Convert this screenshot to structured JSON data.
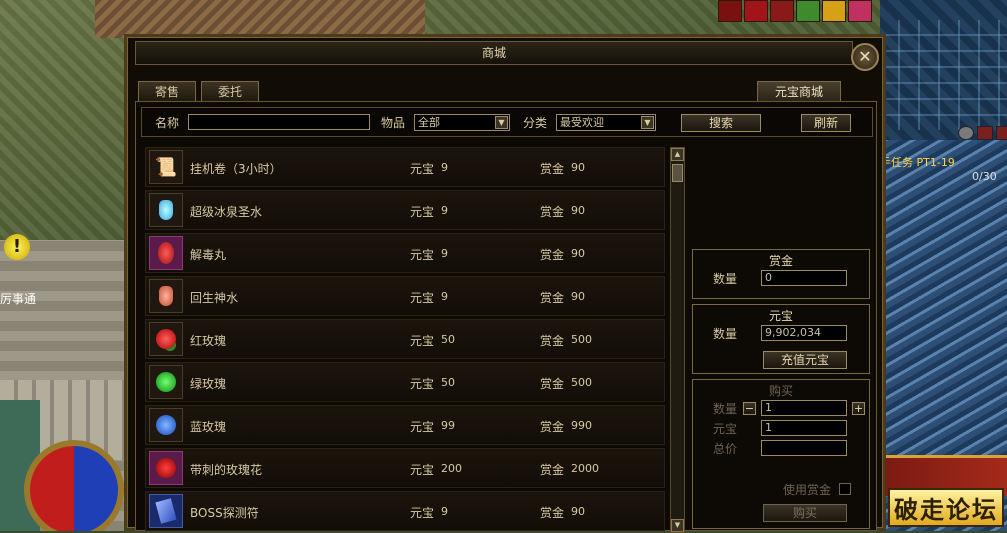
{
  "dialog": {
    "title": "商城",
    "close_symbol": "✕"
  },
  "tabs": {
    "consign": "寄售",
    "entrust": "委托",
    "yuanbao_shop": "元宝商城"
  },
  "toolbar": {
    "name_label": "名称",
    "name_value": "",
    "item_label": "物品",
    "item_value": "全部",
    "category_label": "分类",
    "category_value": "最受欢迎",
    "search_label": "搜索",
    "refresh_label": "刷新"
  },
  "items": [
    {
      "name": "挂机卷（3小时）",
      "price_type": "元宝",
      "price": "9",
      "bounty_type": "赏金",
      "bounty": "90",
      "icon": "scroll-icon"
    },
    {
      "name": "超级冰泉圣水",
      "price_type": "元宝",
      "price": "9",
      "bounty_type": "赏金",
      "bounty": "90",
      "icon": "blue-potion-icon"
    },
    {
      "name": "解毒丸",
      "price_type": "元宝",
      "price": "9",
      "bounty_type": "赏金",
      "bounty": "90",
      "icon": "gourd-icon"
    },
    {
      "name": "回生神水",
      "price_type": "元宝",
      "price": "9",
      "bounty_type": "赏金",
      "bounty": "90",
      "icon": "red-potion-icon"
    },
    {
      "name": "红玫瑰",
      "price_type": "元宝",
      "price": "50",
      "bounty_type": "赏金",
      "bounty": "500",
      "icon": "red-rose-icon"
    },
    {
      "name": "绿玫瑰",
      "price_type": "元宝",
      "price": "50",
      "bounty_type": "赏金",
      "bounty": "500",
      "icon": "green-rose-icon"
    },
    {
      "name": "蓝玫瑰",
      "price_type": "元宝",
      "price": "99",
      "bounty_type": "赏金",
      "bounty": "990",
      "icon": "blue-rose-icon"
    },
    {
      "name": "带刺的玫瑰花",
      "price_type": "元宝",
      "price": "200",
      "bounty_type": "赏金",
      "bounty": "2000",
      "icon": "thorn-rose-icon"
    },
    {
      "name": "BOSS探测符",
      "price_type": "元宝",
      "price": "9",
      "bounty_type": "赏金",
      "bounty": "90",
      "icon": "talisman-icon"
    }
  ],
  "bounty_box": {
    "title": "赏金",
    "qty_label": "数量",
    "qty_value": "0"
  },
  "yuanbao_box": {
    "title": "元宝",
    "qty_label": "数量",
    "qty_value": "9,902,034",
    "recharge_label": "充值元宝"
  },
  "buy_box": {
    "title": "购买",
    "qty_label": "数量",
    "qty_value": "1",
    "minus": "−",
    "plus": "+",
    "yuanbao_label": "元宝",
    "yuanbao_value": "1",
    "total_label": "总价",
    "total_value": "",
    "use_bounty_label": "使用赏金",
    "buy_label": "购买"
  },
  "hud": {
    "npc_name": "厉事通",
    "quest_text": "手任务 PT1-19",
    "quest_count": "0/30",
    "quest_mark": "!",
    "watermark": "破走论坛"
  },
  "colors": {
    "panel_bg": "#120c06",
    "border_gold": "#7a6840",
    "text": "#d8c9a3"
  }
}
